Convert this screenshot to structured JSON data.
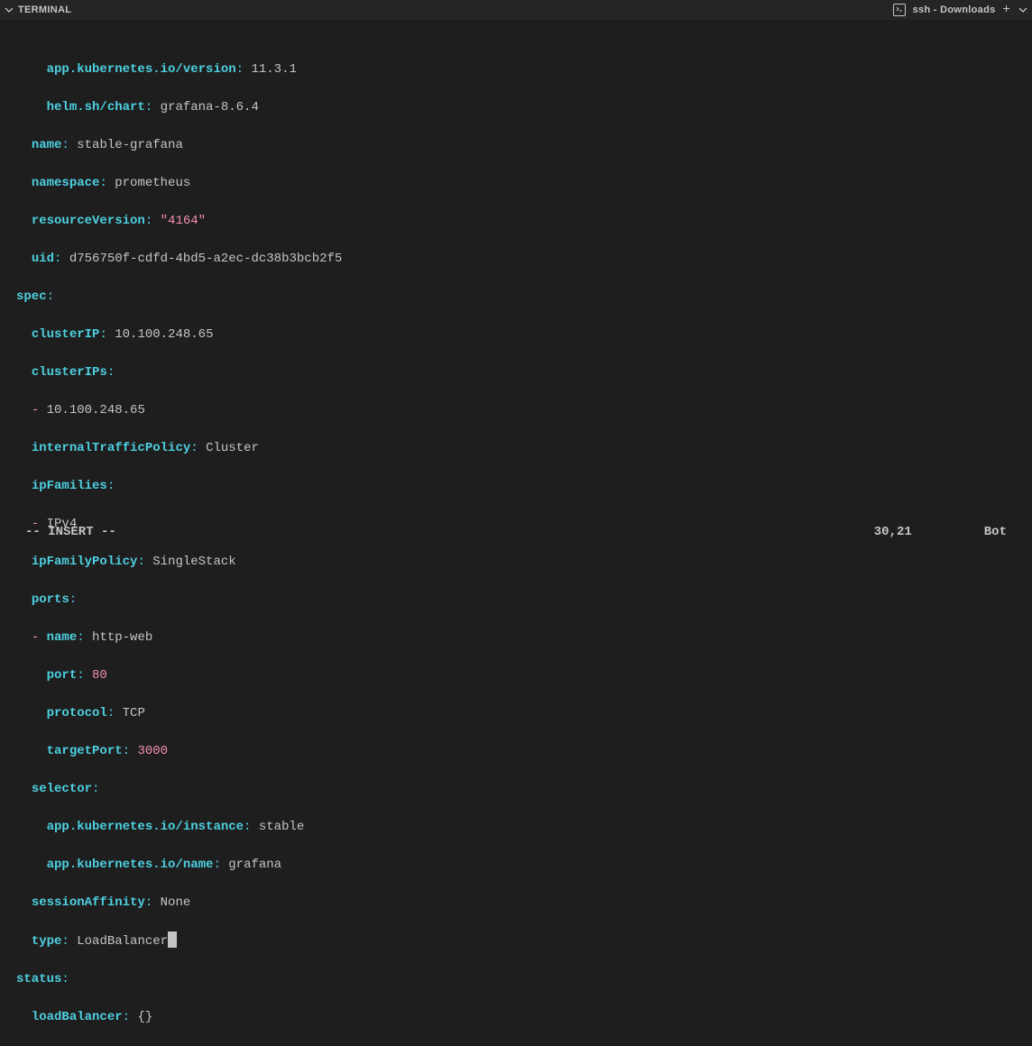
{
  "titlebar": {
    "label": "TERMINAL",
    "tab": "ssh - Downloads"
  },
  "yaml": {
    "l1_k": "app.kubernetes.io/version",
    "l1_v": "11.3.1",
    "l2_k": "helm.sh/chart",
    "l2_v": "grafana-8.6.4",
    "l3_k": "name",
    "l3_v": "stable-grafana",
    "l4_k": "namespace",
    "l4_v": "prometheus",
    "l5_k": "resourceVersion",
    "l5_v": "\"4164\"",
    "l6_k": "uid",
    "l6_v": "d756750f-cdfd-4bd5-a2ec-dc38b3bcb2f5",
    "l7_k": "spec",
    "l8_k": "clusterIP",
    "l8_v": "10.100.248.65",
    "l9_k": "clusterIPs",
    "l10_v": "10.100.248.65",
    "l11_k": "internalTrafficPolicy",
    "l11_v": "Cluster",
    "l12_k": "ipFamilies",
    "l13_v": "IPv4",
    "l14_k": "ipFamilyPolicy",
    "l14_v": "SingleStack",
    "l15_k": "ports",
    "l16_k": "name",
    "l16_v": "http-web",
    "l17_k": "port",
    "l17_v": "80",
    "l18_k": "protocol",
    "l18_v": "TCP",
    "l19_k": "targetPort",
    "l19_v": "3000",
    "l20_k": "selector",
    "l21_k": "app.kubernetes.io/instance",
    "l21_v": "stable",
    "l22_k": "app.kubernetes.io/name",
    "l22_v": "grafana",
    "l23_k": "sessionAffinity",
    "l23_v": "None",
    "l24_k": "type",
    "l24_v": "LoadBalancer",
    "l25_k": "status",
    "l26_k": "loadBalancer",
    "l26_v": "{}"
  },
  "status": {
    "mode": "-- INSERT --",
    "pos": "30,21",
    "scroll": "Bot"
  }
}
